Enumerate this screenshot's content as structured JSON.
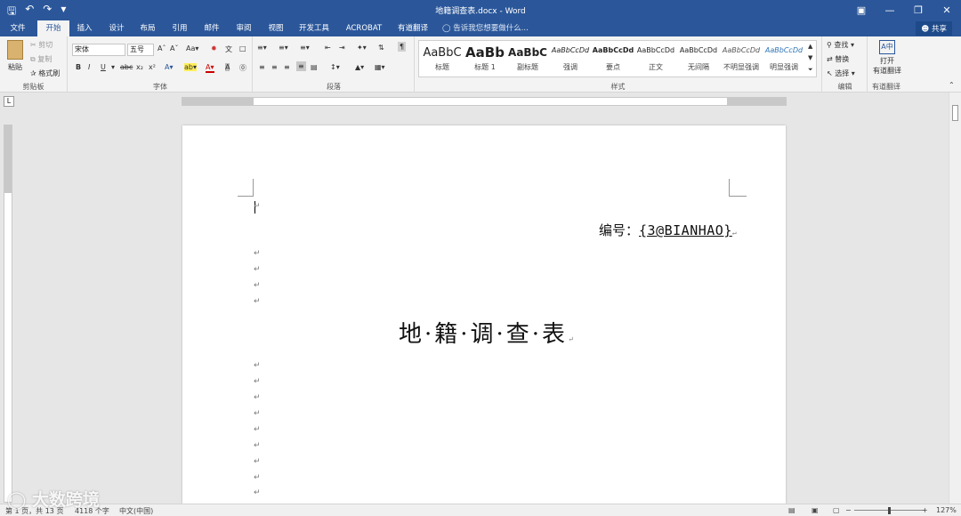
{
  "titlebar": {
    "title": "地籍调查表.docx - Word",
    "save_icon": "save-icon",
    "undo_icon": "undo-icon",
    "redo_icon": "redo-icon"
  },
  "tabs": [
    {
      "label": "文件"
    },
    {
      "label": "开始",
      "active": true
    },
    {
      "label": "插入"
    },
    {
      "label": "设计"
    },
    {
      "label": "布局"
    },
    {
      "label": "引用"
    },
    {
      "label": "邮件"
    },
    {
      "label": "审阅"
    },
    {
      "label": "视图"
    },
    {
      "label": "开发工具"
    },
    {
      "label": "ACROBAT"
    },
    {
      "label": "有道翻译"
    }
  ],
  "tell_me": "告诉我您想要做什么...",
  "share": "共享",
  "clipboard": {
    "paste": "粘贴",
    "cut": "剪切",
    "copy": "复制",
    "format_painter": "格式刷",
    "label": "剪贴板"
  },
  "font": {
    "name": "宋体",
    "size": "五号",
    "label": "字体"
  },
  "paragraph": {
    "label": "段落"
  },
  "styles": {
    "label": "样式",
    "items": [
      {
        "preview": "AaBbC",
        "name": "标题"
      },
      {
        "preview": "AaBb",
        "name": "标题 1"
      },
      {
        "preview": "AaBbC",
        "name": "副标题"
      },
      {
        "preview": "AaBbCcDd",
        "name": "强调"
      },
      {
        "preview": "AaBbCcDd",
        "name": "要点"
      },
      {
        "preview": "AaBbCcDd",
        "name": "正文"
      },
      {
        "preview": "AaBbCcDd",
        "name": "无间隔"
      },
      {
        "preview": "AaBbCcDd",
        "name": "不明显强调"
      },
      {
        "preview": "AaBbCcDd",
        "name": "明显强调"
      }
    ]
  },
  "editing": {
    "find": "查找",
    "replace": "替换",
    "select": "选择",
    "label": "编辑"
  },
  "youdao": {
    "open": "打开",
    "translate": "有道翻译",
    "label": "有道翻译"
  },
  "document": {
    "serial_label": "编号：",
    "serial_value": "{3@BIANHAO}",
    "title": "地·籍·调·查·表"
  },
  "status": {
    "page": "第 1 页，共 13 页",
    "words": "4118 个字",
    "language": "中文(中国)",
    "zoom": "127%"
  },
  "watermark": "大数跨境"
}
